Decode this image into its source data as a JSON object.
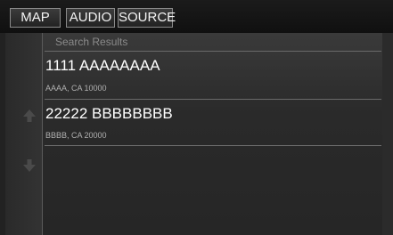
{
  "tabs": [
    {
      "label": "MAP"
    },
    {
      "label": "AUDIO"
    },
    {
      "label": "SOURCE"
    }
  ],
  "list": {
    "header": "Search Results",
    "results": [
      {
        "name": "1111 AAAAAAAA",
        "address": "AAAA, CA 10000"
      },
      {
        "name": "22222 BBBBBBBB",
        "address": "BBBB, CA 20000"
      }
    ]
  },
  "icons": {
    "scroll_up": "arrow-up-icon",
    "scroll_down": "arrow-down-icon"
  },
  "colors": {
    "background": "#222222",
    "text": "#ffffff",
    "subtext": "#b0b0b0",
    "tab_border": "#8a8a8a"
  }
}
